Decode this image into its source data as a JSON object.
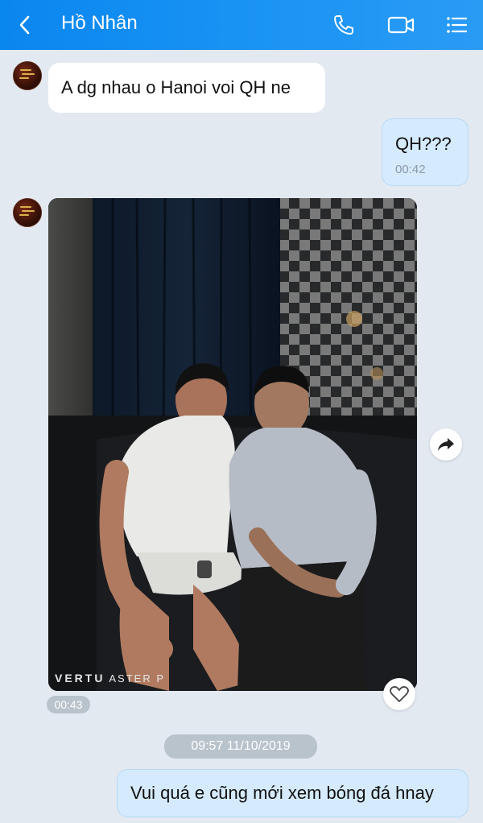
{
  "header": {
    "title": "Hồ Nhân",
    "back_icon": "chevron-left-icon",
    "call_icon": "phone-icon",
    "video_icon": "video-camera-icon",
    "menu_icon": "list-menu-icon",
    "accent": "#0a86ef"
  },
  "messages": [
    {
      "side": "in",
      "text": "A  dg nhau o Hanoi voi QH ne"
    },
    {
      "side": "out",
      "text": "QH???",
      "time": "00:42"
    },
    {
      "side": "in",
      "type": "photo",
      "watermark_brand": "VERTU",
      "watermark_model": "ASTER P",
      "time": "00:43"
    }
  ],
  "date_separator": "09:57 11/10/2019",
  "last_message": {
    "side": "out",
    "text": "Vui quá e cũng mới xem bóng đá hnay"
  },
  "actions": {
    "share_icon": "share-forward-icon",
    "like_icon": "heart-icon"
  },
  "colors": {
    "chat_background": "#e2e9f1",
    "outgoing_bubble": "#d5ebfd",
    "incoming_bubble": "#ffffff"
  }
}
